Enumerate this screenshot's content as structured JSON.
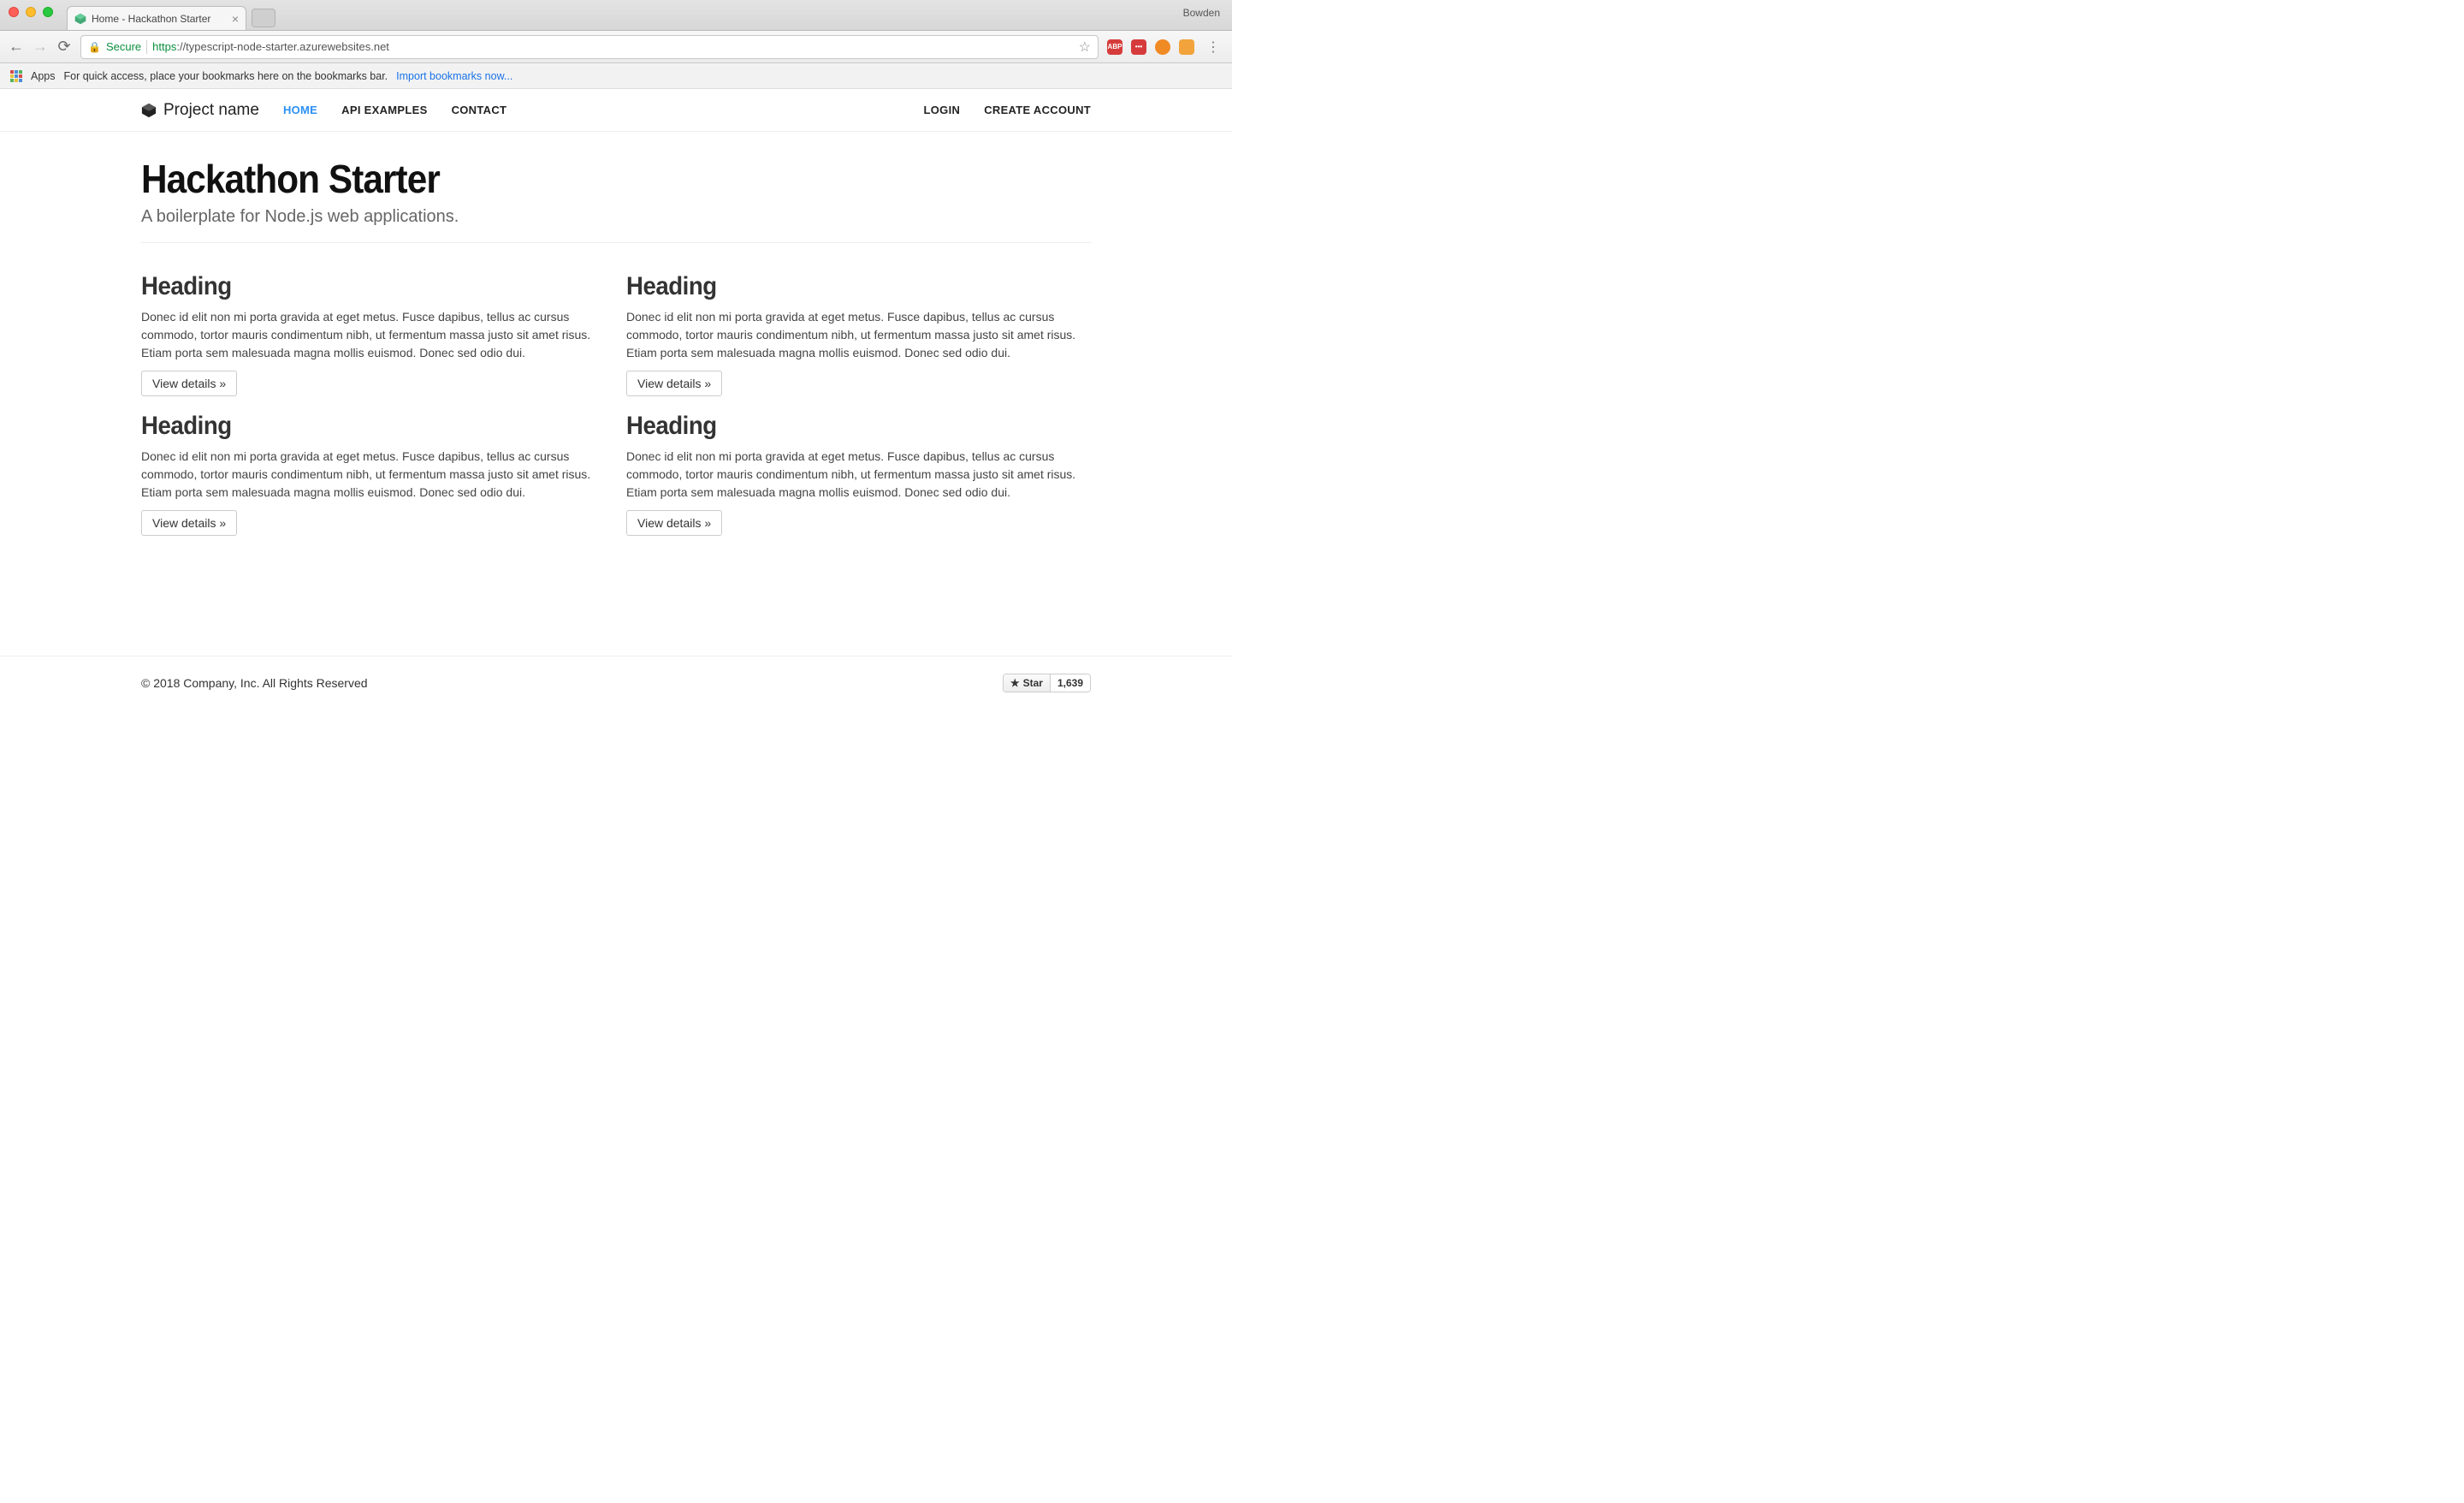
{
  "chrome": {
    "profile": "Bowden",
    "tab": {
      "title": "Home - Hackathon Starter"
    },
    "bookmark_hint": "For quick access, place your bookmarks here on the bookmarks bar.",
    "import_link": "Import bookmarks now...",
    "apps_label": "Apps",
    "omnibox": {
      "secure_label": "Secure",
      "scheme": "https",
      "url_rest": "://typescript-node-starter.azurewebsites.net"
    }
  },
  "nav": {
    "brand": "Project name",
    "links": [
      "HOME",
      "API EXAMPLES",
      "CONTACT"
    ],
    "right": [
      "LOGIN",
      "CREATE ACCOUNT"
    ]
  },
  "hero": {
    "title": "Hackathon Starter",
    "subtitle": "A boilerplate for Node.js web applications."
  },
  "cards": [
    {
      "heading": "Heading",
      "body": "Donec id elit non mi porta gravida at eget metus. Fusce dapibus, tellus ac cursus commodo, tortor mauris condimentum nibh, ut fermentum massa justo sit amet risus. Etiam porta sem malesuada magna mollis euismod. Donec sed odio dui.",
      "button": "View details »"
    },
    {
      "heading": "Heading",
      "body": "Donec id elit non mi porta gravida at eget metus. Fusce dapibus, tellus ac cursus commodo, tortor mauris condimentum nibh, ut fermentum massa justo sit amet risus. Etiam porta sem malesuada magna mollis euismod. Donec sed odio dui.",
      "button": "View details »"
    },
    {
      "heading": "Heading",
      "body": "Donec id elit non mi porta gravida at eget metus. Fusce dapibus, tellus ac cursus commodo, tortor mauris condimentum nibh, ut fermentum massa justo sit amet risus. Etiam porta sem malesuada magna mollis euismod. Donec sed odio dui.",
      "button": "View details »"
    },
    {
      "heading": "Heading",
      "body": "Donec id elit non mi porta gravida at eget metus. Fusce dapibus, tellus ac cursus commodo, tortor mauris condimentum nibh, ut fermentum massa justo sit amet risus. Etiam porta sem malesuada magna mollis euismod. Donec sed odio dui.",
      "button": "View details »"
    }
  ],
  "footer": {
    "copyright": "© 2018 Company, Inc. All Rights Reserved",
    "star_label": "Star",
    "star_count": "1,639"
  }
}
